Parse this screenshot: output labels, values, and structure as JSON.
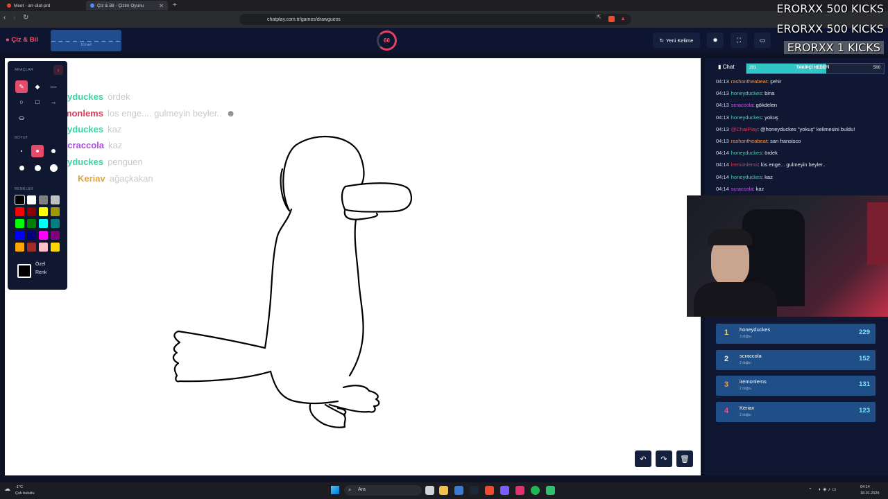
{
  "browser": {
    "tabs": [
      {
        "title": "Meet - arr-diat-prd",
        "color": "#e94235"
      },
      {
        "title": "Çiz & Bil - Çizim Oyunu",
        "color": "#4e8cff"
      }
    ],
    "url": "chatplay.com.tr/games/drawguess"
  },
  "header": {
    "logo": "Çiz & Bil",
    "word_mask": "_ _ _ _ _ _ _ _ _ _",
    "word_hint": "10 harf",
    "timer": "60",
    "new_word_label": "Yeni Kelime"
  },
  "overlay": {
    "kicks": [
      "ERORXX  500 KICKS",
      "ERORXX  500 KICKS",
      "ERORXX  1 KICKS"
    ]
  },
  "tools": {
    "section_tools": "ARAÇLAR",
    "section_size": "BOYUT",
    "section_colors": "RENKLER",
    "custom_color_label_1": "Özel",
    "custom_color_label_2": "Renk",
    "colors": [
      "#000000",
      "#ffffff",
      "#808080",
      "#c0c0c0",
      "#ff0000",
      "#8b0000",
      "#ffff00",
      "#9a9a00",
      "#00ff00",
      "#008000",
      "#00ffff",
      "#008080",
      "#0000ff",
      "#000080",
      "#ff00ff",
      "#800080",
      "#ffa500",
      "#a52a2a",
      "#ffc0cb",
      "#ffd700"
    ]
  },
  "guesses": [
    {
      "user": "honeyduckes",
      "text": "ördek",
      "color": "#3ad6a3"
    },
    {
      "user": "iremonlems",
      "text": "los enge.... gulmeyin beyler..",
      "color": "#e23a56"
    },
    {
      "user": "honeyduckes",
      "text": "kaz",
      "color": "#3ad6a3"
    },
    {
      "user": "scraccola",
      "text": "kaz",
      "color": "#b04ce0"
    },
    {
      "user": "honeyduckes",
      "text": "penguen",
      "color": "#3ad6a3"
    },
    {
      "user": "Keriav",
      "text": "ağaçkakan",
      "color": "#e0a63a"
    }
  ],
  "chat": {
    "title": "Chat",
    "goal_left": "291",
    "goal_label": "TAKİPÇİ HEDEFİ",
    "goal_right": "500",
    "messages": [
      {
        "time": "04:13",
        "user": "rashontheabeat",
        "text": ": şehir",
        "color": "#ff9a3c"
      },
      {
        "time": "04:13",
        "user": "honeyduckes",
        "text": ": bina",
        "color": "#3ad6a3"
      },
      {
        "time": "04:13",
        "user": "scraccola",
        "text": ": gökdelen",
        "color": "#c45be8"
      },
      {
        "time": "04:13",
        "user": "honeyduckes",
        "text": ": yokuş",
        "color": "#3ad6a3"
      },
      {
        "time": "04:13",
        "user": "@ChatPlay",
        "text": ": @honeyduckes \"yokuş\" kelimesini buldu!",
        "color": "#e23a56"
      },
      {
        "time": "04:13",
        "user": "rashontheabeat",
        "text": ": san fransisco",
        "color": "#ff9a3c"
      },
      {
        "time": "04:14",
        "user": "honeyduckes",
        "text": ": ördek",
        "color": "#3ad6a3"
      },
      {
        "time": "04:14",
        "user": "iremonlems",
        "text": ": los enge... gulmeyin beyler..",
        "color": "#e23a56"
      },
      {
        "time": "04:14",
        "user": "honeyduckes",
        "text": ": kaz",
        "color": "#3ad6a3"
      },
      {
        "time": "04:14",
        "user": "scraccola",
        "text": ": kaz",
        "color": "#c45be8"
      }
    ]
  },
  "leaderboard": [
    {
      "rank": "1",
      "name": "honeyduckes",
      "sub": "3 doğru",
      "score": "229",
      "color": "#ffd23f"
    },
    {
      "rank": "2",
      "name": "scraccola",
      "sub": "2 doğru",
      "score": "152",
      "color": "#e8ecf5"
    },
    {
      "rank": "3",
      "name": "iremonlems",
      "sub": "2 doğru",
      "score": "131",
      "color": "#ff9a3c"
    },
    {
      "rank": "4",
      "name": "Keriav",
      "sub": "2 doğru",
      "score": "123",
      "color": "#ff4d8a"
    }
  ],
  "taskbar": {
    "weather_temp": "-1°C",
    "weather_text": "Çok bulutlu",
    "search_label": "Ara",
    "time": "04:14",
    "date": "18.01.2026"
  }
}
